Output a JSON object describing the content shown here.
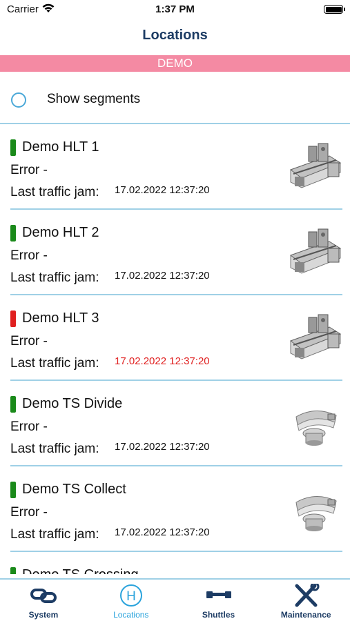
{
  "status_bar": {
    "carrier": "Carrier",
    "time": "1:37 PM"
  },
  "nav": {
    "title": "Locations"
  },
  "banner": {
    "label": "DEMO",
    "color": "#f48aa3"
  },
  "segments": {
    "label": "Show segments",
    "checked": false
  },
  "colors": {
    "ok": "#1a8a1a",
    "error": "#e02020",
    "accent": "#2aa3dc",
    "navy": "#1d3c64"
  },
  "locations": [
    {
      "name": "Demo HLT 1",
      "error": "Error -",
      "jam_label": "Last traffic jam:",
      "jam_time": "17.02.2022 12:37:20",
      "status": "ok",
      "image": "rail-module"
    },
    {
      "name": "Demo HLT 2",
      "error": "Error -",
      "jam_label": "Last traffic jam:",
      "jam_time": "17.02.2022 12:37:20",
      "status": "ok",
      "image": "rail-module"
    },
    {
      "name": "Demo HLT 3",
      "error": "Error -",
      "jam_label": "Last traffic jam:",
      "jam_time": "17.02.2022 12:37:20",
      "status": "error",
      "image": "rail-module"
    },
    {
      "name": "Demo TS Divide",
      "error": "Error -",
      "jam_label": "Last traffic jam:",
      "jam_time": "17.02.2022 12:37:20",
      "status": "ok",
      "image": "curve-switch"
    },
    {
      "name": "Demo TS Collect",
      "error": "Error -",
      "jam_label": "Last traffic jam:",
      "jam_time": "17.02.2022 12:37:20",
      "status": "ok",
      "image": "curve-switch"
    },
    {
      "name": "Demo TS Crossing",
      "error": "",
      "jam_label": "",
      "jam_time": "",
      "status": "ok",
      "image": "none"
    }
  ],
  "tabs": [
    {
      "label": "System",
      "icon": "link-icon",
      "active": false
    },
    {
      "label": "Locations",
      "icon": "h-circle-icon",
      "active": true
    },
    {
      "label": "Shuttles",
      "icon": "shuttle-icon",
      "active": false
    },
    {
      "label": "Maintenance",
      "icon": "tools-icon",
      "active": false
    }
  ]
}
